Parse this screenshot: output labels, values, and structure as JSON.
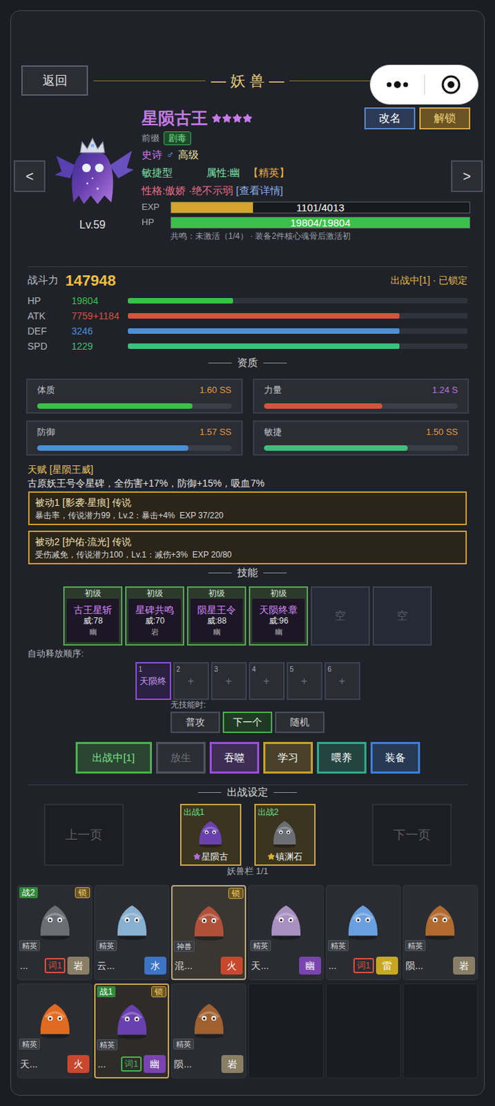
{
  "header": {
    "back": "返回",
    "title": "— 妖 兽 —"
  },
  "profile": {
    "name": "星陨古王",
    "stars": 4,
    "rename": "改名",
    "unlock": "解锁",
    "prev": "<",
    "next": ">",
    "level": "Lv.59",
    "sprite_color": "#6a40b0",
    "prefix_label": "前缀",
    "prefix": "剧毒",
    "rarity": "史诗",
    "gender": "♂",
    "grade": "高级",
    "type": "敏捷型",
    "attribute": "属性:幽",
    "elite": "【精英】",
    "personality": "性格:傲娇 ·绝不示弱",
    "details": "[查看详情]",
    "bars": [
      {
        "label": "EXP",
        "reading": "1101/4013",
        "level": 0.274,
        "color": "#d4a52a"
      },
      {
        "label": "HP",
        "reading": "19804/19804",
        "level": 1,
        "color": "#3cbf4a"
      }
    ],
    "resonance": "共鸣：未激活（1/4） · 装备2件核心魂骨后激活初"
  },
  "power": {
    "label": "战斗力",
    "value": "147948",
    "status": "出战中[1] · 已锁定"
  },
  "stats": [
    {
      "label": "HP",
      "value": "19804",
      "level": 0.31,
      "color": "#3cbf4a"
    },
    {
      "label": "ATK",
      "value": "7759+1184",
      "level": 0.8,
      "color": "#d9513f"
    },
    {
      "label": "DEF",
      "value": "3246",
      "level": 0.8,
      "color": "#4a90d9"
    },
    {
      "label": "SPD",
      "value": "1229",
      "level": 0.8,
      "color": "#3fbf7a"
    }
  ],
  "aptitude": {
    "title": "资质",
    "items": [
      {
        "label": "体质",
        "grade": "1.60 SS",
        "level": 0.8,
        "color": "#3cbf4a",
        "grade_color": "#e89a3c"
      },
      {
        "label": "力量",
        "grade": "1.24 S",
        "level": 0.61,
        "color": "#d9513f",
        "grade_color": "#c070e0"
      },
      {
        "label": "防御",
        "grade": "1.57 SS",
        "level": 0.78,
        "color": "#4a90d9",
        "grade_color": "#e89a3c"
      },
      {
        "label": "敏捷",
        "grade": "1.50 SS",
        "level": 0.74,
        "color": "#3fbf7a",
        "grade_color": "#e89a3c"
      }
    ]
  },
  "talent": {
    "title": "天赋 [星陨王威]",
    "desc": "古原妖王号令星碑，全伤害+17%，防御+15%，吸血7%"
  },
  "passives": [
    {
      "title": "被动1 [影袭·星痕] 传说",
      "desc": "暴击率，传说潜力99，Lv.2：暴击+4%  EXP 37/220"
    },
    {
      "title": "被动2 [护佑·流光] 传说",
      "desc": "受伤减免，传说潜力100，Lv.1：减伤+3%  EXP 20/80"
    }
  ],
  "skills": {
    "title": "技能",
    "slots": [
      {
        "empty": false,
        "grade": "初级",
        "name": "古王星斩",
        "power": "威:78",
        "element": "幽"
      },
      {
        "empty": false,
        "grade": "初级",
        "name": "星碑共鸣",
        "power": "威:70",
        "element": "岩"
      },
      {
        "empty": false,
        "grade": "初级",
        "name": "陨星王令",
        "power": "威:88",
        "element": "幽"
      },
      {
        "empty": false,
        "grade": "初级",
        "name": "天陨终章",
        "power": "威:96",
        "element": "幽"
      },
      {
        "empty": true,
        "grade": "",
        "name": "空",
        "power": "",
        "element": ""
      },
      {
        "empty": true,
        "grade": "",
        "name": "空",
        "power": "",
        "element": ""
      }
    ]
  },
  "auto": {
    "label": "自动释放顺序:",
    "slots": [
      {
        "index": "1",
        "skill": "天陨终",
        "filled": true
      },
      {
        "index": "2",
        "skill": "+",
        "filled": false
      },
      {
        "index": "3",
        "skill": "+",
        "filled": false
      },
      {
        "index": "4",
        "skill": "+",
        "filled": false
      },
      {
        "index": "5",
        "skill": "+",
        "filled": false
      },
      {
        "index": "6",
        "skill": "+",
        "filled": false
      }
    ]
  },
  "fallback": {
    "label": "无技能时:",
    "options": [
      {
        "label": "普攻",
        "selected": false
      },
      {
        "label": "下一个",
        "selected": true
      },
      {
        "label": "随机",
        "selected": false
      }
    ]
  },
  "actions": [
    {
      "label": "出战中[1]",
      "color": "#4caf50",
      "text_color": "#7fe08a",
      "disabled": false
    },
    {
      "label": "放生",
      "color": "#50555d",
      "text_color": "#6e727a",
      "disabled": true
    },
    {
      "label": "吞噬",
      "color": "#9b4fd6",
      "text_color": "#ffffff",
      "disabled": false
    },
    {
      "label": "学习",
      "color": "#c9a030",
      "text_color": "#ffffff",
      "disabled": false
    },
    {
      "label": "喂养",
      "color": "#2faa8a",
      "text_color": "#ffffff",
      "disabled": false
    },
    {
      "label": "装备",
      "color": "#3f7fd8",
      "text_color": "#ffffff",
      "disabled": false
    }
  ],
  "dispatch": {
    "title": "出战设定",
    "prev": "上一页",
    "next": "下一页",
    "caption": "妖兽栏 1/1",
    "slots": [
      {
        "label": "出战1",
        "name": "星陨古",
        "star_color": "#b070e0",
        "sprite_color": "#6a40b0"
      },
      {
        "label": "出战2",
        "name": "镇渊石",
        "star_color": "#e0b030",
        "sprite_color": "#6b6e75"
      }
    ]
  },
  "grid": {
    "lock_label": "锁",
    "empty_slots": 3,
    "items": [
      {
        "battle": "战2",
        "locked": true,
        "rarity": "精英",
        "name": "...",
        "affix": "词1",
        "affix_color": "#d9513f",
        "element": "岩",
        "element_color": "#8a7f66",
        "kind": "normal",
        "selected": false,
        "sprite_color": "#6b6e75"
      },
      {
        "battle": "",
        "locked": false,
        "rarity": "精英",
        "name": "云...",
        "affix": "",
        "affix_color": "",
        "element": "水",
        "element_color": "#3c74c8",
        "kind": "normal",
        "selected": false,
        "sprite_color": "#8ab0d0"
      },
      {
        "battle": "",
        "locked": true,
        "rarity": "神兽",
        "name": "混...",
        "affix": "",
        "affix_color": "",
        "element": "火",
        "element_color": "#c8482e",
        "kind": "divine",
        "selected": false,
        "sprite_color": "#b0503a"
      },
      {
        "battle": "",
        "locked": false,
        "rarity": "精英",
        "name": "天...",
        "affix": "",
        "affix_color": "",
        "element": "幽",
        "element_color": "#7a44b0",
        "kind": "normal",
        "selected": false,
        "sprite_color": "#a890c0"
      },
      {
        "battle": "",
        "locked": false,
        "rarity": "精英",
        "name": "...",
        "affix": "词1",
        "affix_color": "#d9513f",
        "element": "雷",
        "element_color": "#c8a820",
        "kind": "normal",
        "selected": false,
        "sprite_color": "#6aa0e0"
      },
      {
        "battle": "",
        "locked": false,
        "rarity": "精英",
        "name": "陨...",
        "affix": "",
        "affix_color": "",
        "element": "岩",
        "element_color": "#8a7f66",
        "kind": "normal",
        "selected": false,
        "sprite_color": "#b06a30"
      },
      {
        "battle": "",
        "locked": false,
        "rarity": "精英",
        "name": "天...",
        "affix": "",
        "affix_color": "",
        "element": "火",
        "element_color": "#c8482e",
        "kind": "normal",
        "selected": false,
        "sprite_color": "#e06a20"
      },
      {
        "battle": "战1",
        "locked": true,
        "rarity": "精英",
        "name": "...",
        "affix": "词1",
        "affix_color": "#4caf50",
        "element": "幽",
        "element_color": "#7a44b0",
        "kind": "normal",
        "selected": true,
        "sprite_color": "#6a40b0"
      },
      {
        "battle": "",
        "locked": false,
        "rarity": "精英",
        "name": "陨...",
        "affix": "",
        "affix_color": "",
        "element": "岩",
        "element_color": "#8a7f66",
        "kind": "normal",
        "selected": false,
        "sprite_color": "#a06030"
      }
    ]
  }
}
